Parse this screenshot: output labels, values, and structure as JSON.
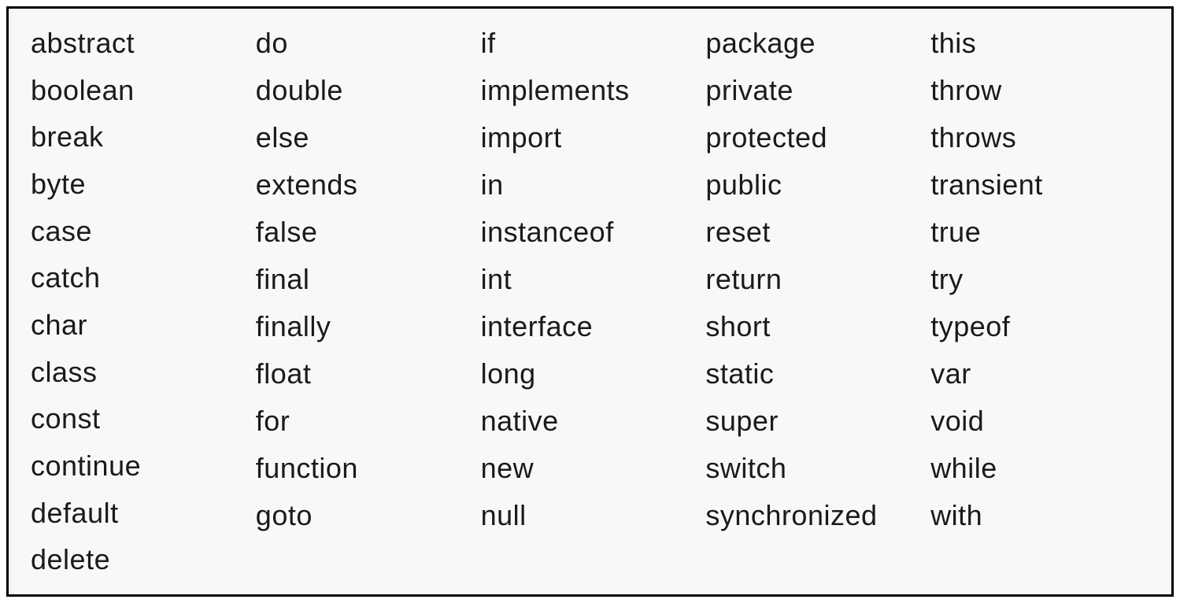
{
  "table": {
    "columns": [
      [
        "abstract",
        "boolean",
        "break",
        "byte",
        "case",
        "catch",
        "char",
        "class",
        "const",
        "continue",
        "default",
        "delete"
      ],
      [
        "do",
        "double",
        "else",
        "extends",
        "false",
        "final",
        "finally",
        "float",
        "for",
        "function",
        "goto"
      ],
      [
        "if",
        "implements",
        "import",
        "in",
        "instanceof",
        "int",
        "interface",
        "long",
        "native",
        "new",
        "null"
      ],
      [
        "package",
        "private",
        "protected",
        "public",
        "reset",
        "return",
        "short",
        "static",
        "super",
        "switch",
        "synchronized"
      ],
      [
        "this",
        "throw",
        "throws",
        "transient",
        "true",
        "try",
        "typeof",
        "var",
        "void",
        "while",
        "with"
      ]
    ]
  }
}
